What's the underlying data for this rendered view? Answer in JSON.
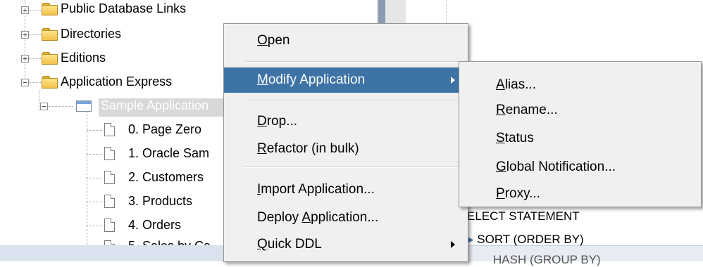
{
  "tree": {
    "nodes": [
      {
        "label": "Public Database Links"
      },
      {
        "label": "Directories"
      },
      {
        "label": "Editions"
      },
      {
        "label": "Application Express"
      },
      {
        "label": "Sample Application"
      },
      {
        "label": "0. Page Zero"
      },
      {
        "label": "1. Oracle Sam"
      },
      {
        "label": "2. Customers"
      },
      {
        "label": "3. Products"
      },
      {
        "label": "4. Orders"
      },
      {
        "label": "5. Sales by Ca"
      }
    ]
  },
  "plan": {
    "line1": "ELECT STATEMENT",
    "line2": "SORT (ORDER BY)",
    "line3": "HASH (GROUP BY)"
  },
  "context_menu": {
    "items": [
      {
        "pre": "",
        "key": "O",
        "post": "pen"
      },
      {
        "pre": "",
        "key": "M",
        "post": "odify Application"
      },
      {
        "pre": "",
        "key": "D",
        "post": "rop..."
      },
      {
        "pre": "",
        "key": "R",
        "post": "efactor (in bulk)"
      },
      {
        "pre": "",
        "key": "I",
        "post": "mport Application..."
      },
      {
        "pre": "Deploy ",
        "key": "A",
        "post": "pplication..."
      },
      {
        "pre": "",
        "key": "Q",
        "post": "uick DDL"
      }
    ]
  },
  "submenu": {
    "items": [
      {
        "key": "A",
        "post": "lias..."
      },
      {
        "key": "R",
        "post": "ename..."
      },
      {
        "key": "S",
        "post": "tatus"
      },
      {
        "key": "G",
        "post": "lobal Notification..."
      },
      {
        "key": "P",
        "post": "roxy..."
      }
    ]
  },
  "colors": {
    "highlight": "#3e73a6",
    "menu_bg": "#f0f0f0",
    "folder": "#f2c14a"
  }
}
